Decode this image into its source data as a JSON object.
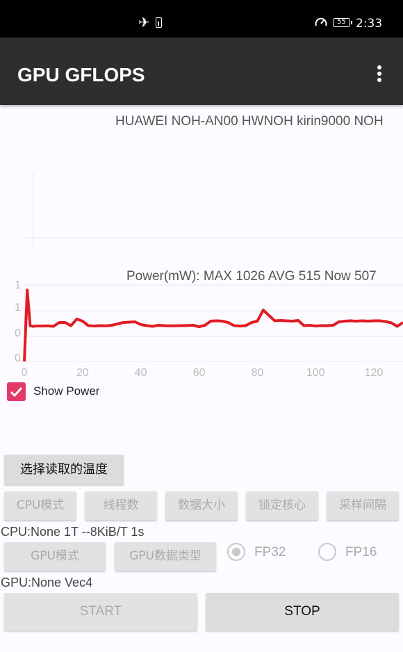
{
  "status_bar": {
    "time": "2:33",
    "battery_level": "55",
    "icons": [
      "airplane-mode-icon",
      "battery-saver-icon",
      "speed-icon",
      "battery-icon"
    ]
  },
  "app_bar": {
    "title": "GPU GFLOPS",
    "menu_icon": "more-vertical-icon"
  },
  "device_info": "HUAWEI NOH-AN00 HWNOH kirin9000 NOH",
  "power_summary": "Power(mW): MAX 1026 AVG 515 Now 507",
  "chart_data": {
    "type": "line",
    "title": "",
    "x": [
      0,
      1,
      2,
      3,
      4,
      6,
      8,
      10,
      12,
      14,
      16,
      18,
      20,
      22,
      24,
      26,
      28,
      30,
      34,
      38,
      40,
      42,
      44,
      46,
      48,
      50,
      54,
      58,
      60,
      62,
      64,
      66,
      68,
      70,
      72,
      74,
      76,
      78,
      80,
      82,
      84,
      86,
      88,
      90,
      92,
      94,
      96,
      98,
      100,
      102,
      104,
      106,
      108,
      110,
      112,
      114,
      116,
      118,
      120,
      122,
      124,
      126,
      128,
      130
    ],
    "y": [
      0,
      1026,
      515,
      505,
      510,
      510,
      512,
      505,
      560,
      560,
      515,
      610,
      580,
      515,
      510,
      515,
      512,
      520,
      560,
      570,
      530,
      515,
      505,
      520,
      515,
      512,
      515,
      520,
      500,
      520,
      580,
      585,
      580,
      560,
      515,
      510,
      515,
      560,
      580,
      740,
      660,
      585,
      590,
      585,
      580,
      590,
      515,
      520,
      510,
      515,
      515,
      520,
      570,
      580,
      585,
      580,
      585,
      580,
      585,
      585,
      575,
      555,
      505,
      560
    ],
    "xticks": [
      "0",
      "20",
      "40",
      "60",
      "80",
      "100",
      "120"
    ],
    "yticks": [
      "0",
      "0",
      "1",
      "1"
    ],
    "ylim": [
      0,
      1100
    ],
    "xlim": [
      0,
      130
    ],
    "series_color": "#e01b24",
    "grid": true
  },
  "show_power": {
    "label": "Show Power",
    "checked": true,
    "color": "#e4386a"
  },
  "temp_button": "选择读取的温度",
  "cpu_buttons": [
    "CPU模式",
    "线程数",
    "数据大小",
    "锁定核心",
    "采样间隔"
  ],
  "cpu_info": "CPU:None 1T --8KiB/T 1s",
  "gpu_buttons": [
    "GPU模式",
    "GPU数据类型"
  ],
  "precision": {
    "fp32": "FP32",
    "fp16": "FP16",
    "selected": "FP32"
  },
  "gpu_info": "GPU:None Vec4",
  "actions": {
    "start": "START",
    "stop": "STOP"
  }
}
